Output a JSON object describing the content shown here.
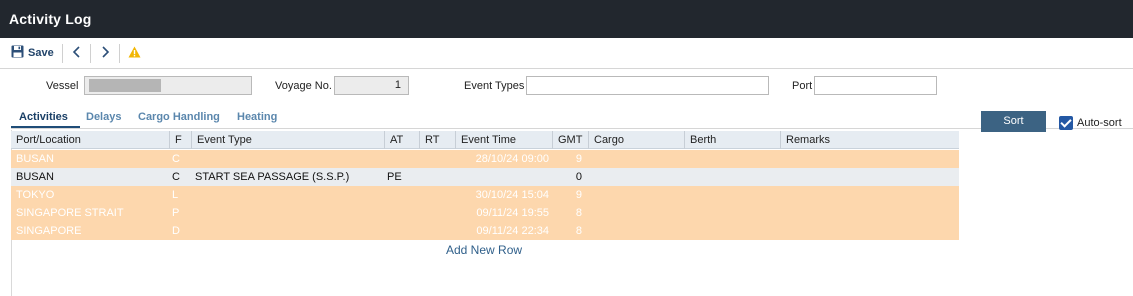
{
  "app": {
    "title": "Activity Log"
  },
  "toolbar": {
    "save_label": "Save",
    "icons": [
      "floppy-disk-icon",
      "chevron-left-icon",
      "chevron-right-icon",
      "warning-icon"
    ]
  },
  "form": {
    "vessel_label": "Vessel",
    "voyage_label": "Voyage No.",
    "voyage_value": "1",
    "event_types_label": "Event Types",
    "event_types_value": "",
    "port_label": "Port",
    "port_value": ""
  },
  "tabs": [
    {
      "label": "Activities",
      "active": true
    },
    {
      "label": "Delays",
      "active": false
    },
    {
      "label": "Cargo Handling",
      "active": false
    },
    {
      "label": "Heating",
      "active": false
    }
  ],
  "sort_button": "Sort",
  "auto_sort": {
    "label": "Auto-sort",
    "checked": true
  },
  "grid": {
    "columns": [
      "Port/Location",
      "F",
      "Event Type",
      "AT",
      "RT",
      "Event Time",
      "GMT",
      "Cargo",
      "Berth",
      "Remarks"
    ],
    "rows": [
      {
        "port": "BUSAN",
        "f": "C",
        "event_type": "",
        "at": "",
        "rt": "",
        "event_time": "28/10/24 09:00",
        "gmt": "9",
        "cargo": "",
        "berth": "",
        "remarks": "",
        "style": "orange"
      },
      {
        "port": "BUSAN",
        "f": "C",
        "event_type": "START SEA PASSAGE (S.S.P.)",
        "at": "PE",
        "rt": "",
        "event_time": "",
        "gmt": "0",
        "cargo": "",
        "berth": "",
        "remarks": "",
        "style": "selected"
      },
      {
        "port": "TOKYO",
        "f": "L",
        "event_type": "",
        "at": "",
        "rt": "",
        "event_time": "30/10/24 15:04",
        "gmt": "9",
        "cargo": "",
        "berth": "",
        "remarks": "",
        "style": "orange"
      },
      {
        "port": "SINGAPORE STRAIT",
        "f": "P",
        "event_type": "",
        "at": "",
        "rt": "",
        "event_time": "09/11/24 19:55",
        "gmt": "8",
        "cargo": "",
        "berth": "",
        "remarks": "",
        "style": "orange"
      },
      {
        "port": "SINGAPORE",
        "f": "D",
        "event_type": "",
        "at": "",
        "rt": "",
        "event_time": "09/11/24 22:34",
        "gmt": "8",
        "cargo": "",
        "berth": "",
        "remarks": "",
        "style": "orange"
      }
    ],
    "add_row_label": "Add New Row"
  },
  "colors": {
    "titlebar": "#22272e",
    "row_highlight": "#fdd7ad",
    "row_selected": "#eaedf0",
    "accent": "#3c6383",
    "tab_active": "#1a3f66",
    "warning": "#f2b705"
  }
}
